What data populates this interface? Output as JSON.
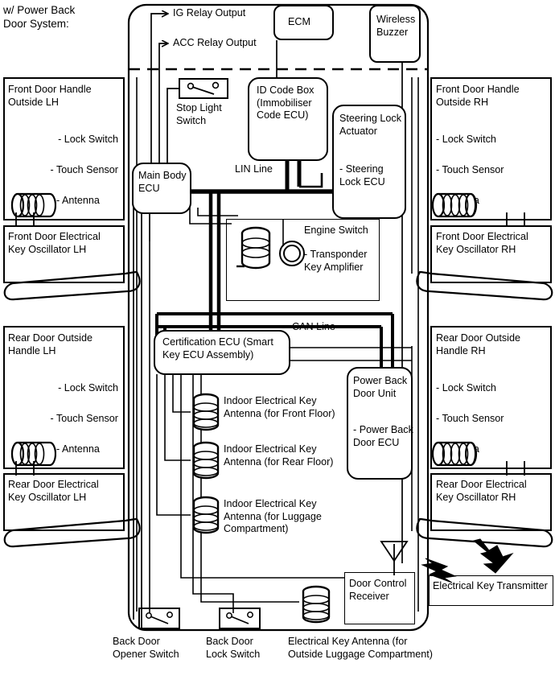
{
  "diagram": {
    "heading": "w/ Power Back\nDoor System:",
    "outputs": [
      {
        "name": "ig-relay-output",
        "label": "IG Relay Output"
      },
      {
        "name": "acc-relay-output",
        "label": "ACC Relay Output"
      }
    ],
    "bus_labels": [
      {
        "name": "lin-line",
        "label": "LIN Line"
      },
      {
        "name": "can-line",
        "label": "CAN Line"
      }
    ],
    "left_modules": [
      {
        "name": "front-door-handle-outside-lh",
        "title": "Front Door Handle\nOutside LH",
        "items": [
          "- Lock Switch",
          "- Touch Sensor",
          "- Antenna"
        ],
        "has_antenna_coil": true
      },
      {
        "name": "front-door-electrical-key-oscillator-lh",
        "title": "Front Door Electrical\nKey Oscillator LH",
        "items": [],
        "has_antenna_coil": false
      },
      {
        "name": "rear-door-outside-handle-lh",
        "title": "Rear Door Outside\nHandle LH",
        "items": [
          "- Lock Switch",
          "- Touch Sensor",
          "- Antenna"
        ],
        "has_antenna_coil": true
      },
      {
        "name": "rear-door-electrical-key-oscillator-lh",
        "title": "Rear Door Electrical\nKey Oscillator LH",
        "items": [],
        "has_antenna_coil": false
      }
    ],
    "right_modules": [
      {
        "name": "front-door-handle-outside-rh",
        "title": "Front Door Handle\nOutside RH",
        "items": [
          "- Lock Switch",
          "- Touch Sensor",
          "- Antenna"
        ],
        "has_antenna_coil": true
      },
      {
        "name": "front-door-electrical-key-oscillator-rh",
        "title": "Front Door Electrical\nKey Oscillator RH",
        "items": [],
        "has_antenna_coil": false
      },
      {
        "name": "rear-door-outside-handle-rh",
        "title": "Rear Door Outside\nHandle RH",
        "items": [
          "- Lock Switch",
          "- Touch Sensor",
          "- Antenna"
        ],
        "has_antenna_coil": true
      },
      {
        "name": "rear-door-electrical-key-oscillator-rh",
        "title": "Rear Door Electrical\nKey Oscillator RH",
        "items": [],
        "has_antenna_coil": false
      }
    ],
    "nodes": {
      "ecm": "ECM",
      "wireless_buzzer": "Wireless\nBuzzer",
      "id_code_box": "ID Code Box\n(Immobiliser\nCode ECU)",
      "steering_lock_actuator": "Steering Lock\nActuator",
      "steering_lock_ecu": "- Steering\nLock ECU",
      "main_body_ecu": "Main Body\nECU",
      "stop_light_switch": "Stop Light\nSwitch",
      "engine_switch": "Engine Switch",
      "transponder_key_amplifier": "- Transponder\nKey Amplifier",
      "certification_ecu": "Certification ECU (Smart\nKey ECU Assembly)",
      "power_back_door_unit": "Power Back\nDoor Unit",
      "power_back_door_ecu": "- Power Back\nDoor ECU",
      "door_control_receiver": "Door Control\nReceiver",
      "electrical_key_transmitter": "Electrical Key Transmitter"
    },
    "indoor_antennas": [
      {
        "name": "indoor-electrical-key-antenna-front-floor",
        "label": "Indoor Electrical Key\nAntenna (for Front Floor)"
      },
      {
        "name": "indoor-electrical-key-antenna-rear-floor",
        "label": "Indoor Electrical Key\nAntenna (for Rear Floor)"
      },
      {
        "name": "indoor-electrical-key-antenna-luggage",
        "label": "Indoor Electrical Key\nAntenna (for Luggage\nCompartment)"
      }
    ],
    "bottom_switches": [
      {
        "name": "back-door-opener-switch",
        "label": "Back Door\nOpener Switch"
      },
      {
        "name": "back-door-lock-switch",
        "label": "Back Door\nLock Switch"
      },
      {
        "name": "electrical-key-antenna-outside-luggage",
        "label": "Electrical Key Antenna (for\nOutside Luggage Compartment)"
      }
    ],
    "colors": {
      "line": "#000000",
      "background": "#ffffff"
    }
  }
}
